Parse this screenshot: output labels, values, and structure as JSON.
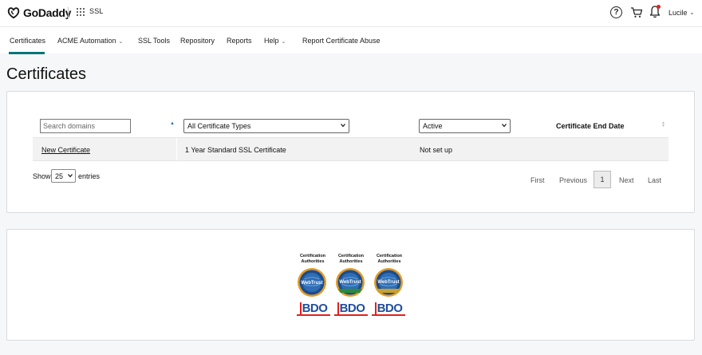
{
  "header": {
    "brand": "GoDaddy",
    "product": "SSL",
    "user": "Lucile",
    "icons": [
      "help-icon",
      "cart-icon",
      "bell-icon"
    ]
  },
  "nav": {
    "items": [
      {
        "label": "Certificates",
        "active": true,
        "dropdown": false
      },
      {
        "label": "ACME Automation",
        "active": false,
        "dropdown": true
      },
      {
        "label": "SSL Tools",
        "active": false,
        "dropdown": false
      },
      {
        "label": "Repository",
        "active": false,
        "dropdown": false
      },
      {
        "label": "Reports",
        "active": false,
        "dropdown": false
      },
      {
        "label": "Help",
        "active": false,
        "dropdown": true
      },
      {
        "label": "Report Certificate Abuse",
        "active": false,
        "dropdown": false
      }
    ]
  },
  "page": {
    "title": "Certificates"
  },
  "table": {
    "search_placeholder": "Search domains",
    "type_filter": "All Certificate Types",
    "status_filter": "Active",
    "end_date_header": "Certificate End Date",
    "rows": [
      {
        "name": "New Certificate",
        "type": "1 Year Standard SSL Certificate",
        "status": "Not set up"
      }
    ],
    "show_label": "Show",
    "entries_value": "25",
    "entries_label": "entries"
  },
  "pagination": {
    "first": "First",
    "previous": "Previous",
    "current": "1",
    "next": "Next",
    "last": "Last"
  },
  "badges": [
    {
      "caption_1": "Certification",
      "caption_2": "Authorities",
      "seal_text": "WebTrust",
      "bdo": "BDO"
    },
    {
      "caption_1": "Certification",
      "caption_2": "Authorities",
      "seal_text": "WebTrust",
      "bdo": "BDO"
    },
    {
      "caption_1": "Certification",
      "caption_2": "Authorities",
      "seal_text": "WebTrust",
      "bdo": "BDO"
    }
  ],
  "colors": {
    "accent": "#09757a",
    "link_blue": "#1d6fc9",
    "bdo_blue": "#1f4e9d",
    "bdo_red": "#e0211d"
  }
}
